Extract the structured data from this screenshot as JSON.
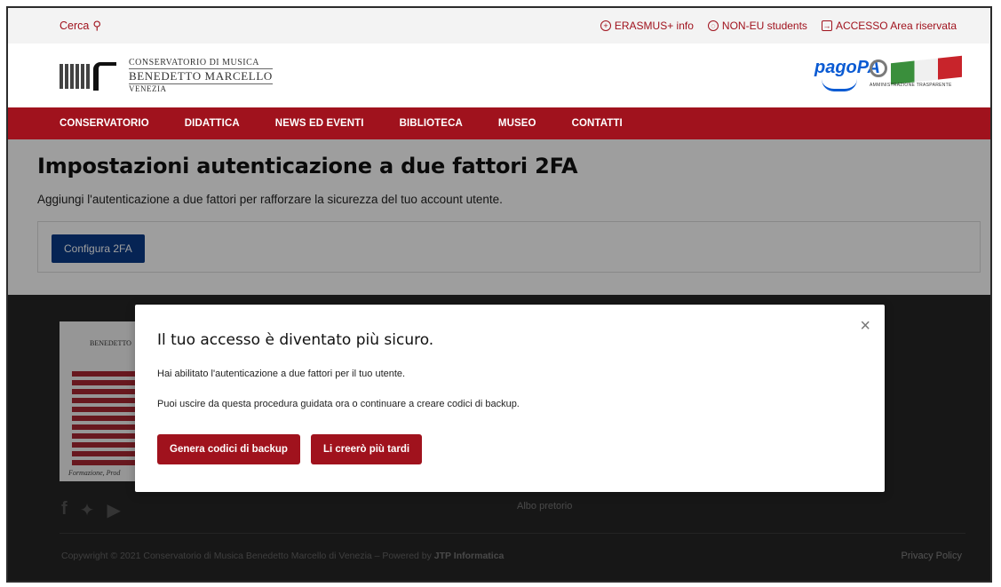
{
  "topbar": {
    "search_label": "Cerca",
    "links": [
      {
        "icon": "plus-circle-icon",
        "label": "ERASMUS+ info"
      },
      {
        "icon": "globe-icon",
        "label": "NON-EU students"
      },
      {
        "icon": "login-icon",
        "label": "ACCESSO Area riservata"
      }
    ]
  },
  "brand": {
    "logo_line1": "CONSERVATORIO DI MUSICA",
    "logo_line2": "BENEDETTO MARCELLO",
    "logo_line3": "VENEZIA",
    "pagopa": "pagoPA",
    "amministrazione": "AMMINISTRAZIONE TRASPARENTE"
  },
  "nav": {
    "items": [
      "CONSERVATORIO",
      "DIDATTICA",
      "NEWS ED EVENTI",
      "BIBLIOTECA",
      "MUSEO",
      "CONTATTI"
    ]
  },
  "main": {
    "title": "Impostazioni autenticazione a due fattori 2FA",
    "subtitle": "Aggiungi l'autenticazione a due fattori per rafforzare la sicurezza del tuo account utente.",
    "configure_button": "Configura 2FA"
  },
  "footer": {
    "badge_text": "BENEDETTO",
    "motto": "Formazione, Prod",
    "albo": "Albo pretorio",
    "copyright_prefix": "Copywright © 2021 Conservatorio di Musica Benedetto Marcello di Venezia – Powered by ",
    "copyright_brand": "JTP Informatica",
    "privacy": "Privacy Policy"
  },
  "modal": {
    "title": "Il tuo accesso è diventato più sicuro.",
    "line1": "Hai abilitato l'autenticazione a due fattori per il tuo utente.",
    "line2": "Puoi uscire da questa procedura guidata ora o continuare a creare codici di backup.",
    "primary_button": "Genera codici di backup",
    "secondary_button": "Li creerò più tardi",
    "close_symbol": "×"
  },
  "colors": {
    "brand_red": "#a0121d",
    "nav_blue": "#0a3a88",
    "footer_bg": "#262626"
  }
}
